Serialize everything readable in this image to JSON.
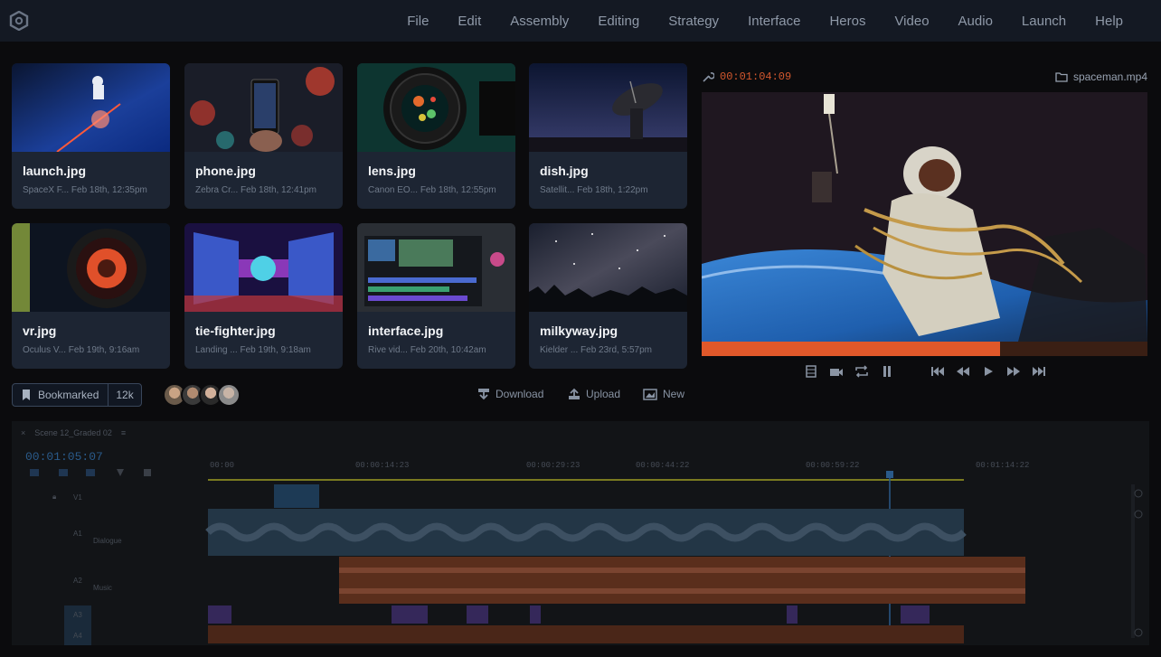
{
  "menu": [
    "File",
    "Edit",
    "Assembly",
    "Editing",
    "Strategy",
    "Interface",
    "Heros",
    "Video",
    "Audio",
    "Launch",
    "Help"
  ],
  "gallery": [
    {
      "name": "launch.jpg",
      "source": "SpaceX F...",
      "date": "Feb 18th, 12:35pm"
    },
    {
      "name": "phone.jpg",
      "source": "Zebra Cr...",
      "date": "Feb 18th, 12:41pm"
    },
    {
      "name": "lens.jpg",
      "source": "Canon EO...",
      "date": "Feb 18th, 12:55pm"
    },
    {
      "name": "dish.jpg",
      "source": "Satellit...",
      "date": "Feb 18th, 1:22pm"
    },
    {
      "name": "vr.jpg",
      "source": "Oculus V...",
      "date": "Feb 19th, 9:16am"
    },
    {
      "name": "tie-fighter.jpg",
      "source": "Landing ...",
      "date": "Feb 19th, 9:18am"
    },
    {
      "name": "interface.jpg",
      "source": "Rive vid...",
      "date": "Feb 20th, 10:42am"
    },
    {
      "name": "milkyway.jpg",
      "source": "Kielder ...",
      "date": "Feb 23rd, 5:57pm"
    }
  ],
  "actions": {
    "bookmark_label": "Bookmarked",
    "bookmark_count": "12k",
    "download": "Download",
    "upload": "Upload",
    "new": "New"
  },
  "player": {
    "timecode": "00:01:04:09",
    "filename": "spaceman.mp4",
    "progress": 0.67
  },
  "timeline": {
    "sequence_name": "Scene 12_Graded 02",
    "timecode": "00:01:05:07",
    "ruler": [
      "00:00",
      "00:00:14:23",
      "00:00:29:23",
      "00:00:44:22",
      "00:00:59:22",
      "00:01:14:22"
    ],
    "tracks": [
      "V1",
      "A1",
      "A2",
      "A3",
      "A4"
    ],
    "track_names": [
      "Dialogue",
      "Music"
    ]
  },
  "colors": {
    "accent": "#e0582a",
    "panel": "#1d2533",
    "menubar": "#141923"
  }
}
